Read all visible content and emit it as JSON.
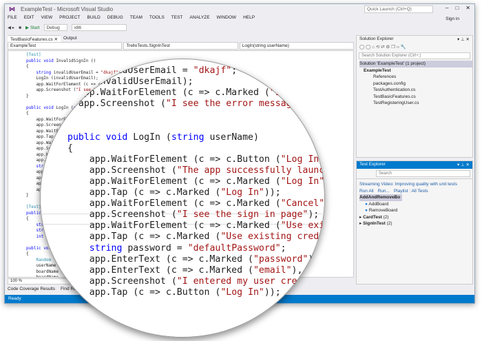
{
  "window": {
    "title": "ExampleTest - Microsoft Visual Studio",
    "quick_launch": "Quick Launch (Ctrl+Q)",
    "sign_in": "Sign in"
  },
  "menu": [
    "FILE",
    "EDIT",
    "VIEW",
    "PROJECT",
    "BUILD",
    "DEBUG",
    "TEAM",
    "TOOLS",
    "TEST",
    "ANALYZE",
    "WINDOW",
    "HELP"
  ],
  "toolbar": {
    "start": "▶ Start",
    "config": "Debug",
    "platform": "x86"
  },
  "tabs": [
    "TestBasicFeatures.cs",
    "Output"
  ],
  "nav": {
    "project": "ExampleTest",
    "class": "TrelloTests.SignInTest",
    "member": "LogIn(string userName)"
  },
  "editor": {
    "zoom": "100 %",
    "lines": [
      "[Test]",
      "public void InvalidSignIn ()",
      "{",
      "    string invalidUserEmail = \"dkajf\";",
      "    LogIn (invalidUserEmail);",
      "    app.WaitForElement (c => c.Marked (\"I see the pop up error\");",
      "    app.Screenshot (\"I see the error message\");",
      "}",
      "",
      "public void LogIn (string userName)",
      "{",
      "    app.WaitForElement",
      "    app.Screenshot",
      "    app.WaitForElement",
      "    app.Tap",
      "    app.WaitForElement",
      "    app.Screenshot",
      "    app.WaitForElement",
      "    app.Tap",
      "    string password",
      "    app.EnterText",
      "    app.EnterText",
      "    app.Screenshot",
      "    app.Tap",
      "}",
      "",
      "[Test]",
      "public void",
      "{",
      "    string",
      "    string",
      "    int",
      "",
      "public void",
      "{",
      "    Random",
      "    userName",
      "    boardName",
      "    boardName"
    ]
  },
  "magnifier": {
    "lines": [
      "    invalidUserEmail = \"dkajf\";",
      "    (invalidUserEmail);",
      "  app.WaitForElement (c => c.Marked (\"I see the pop up error\");",
      "  app.Screenshot (\"I see the error message\");",
      "",
      "",
      "public void LogIn (string userName)",
      "{",
      "    app.WaitForElement (c => c.Button (\"Log In\"));",
      "    app.Screenshot (\"The app successfully launched\");",
      "    app.WaitForElement (c => c.Marked (\"Log In\"));",
      "    app.Tap (c => c.Marked (\"Log In\"));",
      "    app.WaitForElement (c => c.Marked (\"Cancel\"));",
      "    app.Screenshot (\"I see the sign in page\");",
      "    app.WaitForElement (c => c.Marked (\"Use existing\"));",
      "    app.Tap (c => c.Marked (\"Use existing credentials\"));",
      "    string password = \"defaultPassword\";",
      "    app.EnterText (c => c.Marked (\"password\"), password);",
      "    app.EnterText (c => c.Marked (\"email\"), userName);",
      "    app.Screenshot (\"I entered my user credentials\");",
      "    app.Tap (c => c.Button (\"Log In\"));"
    ]
  },
  "bottom_tabs": [
    "Code Coverage Results",
    "Find Results 1"
  ],
  "status": "Ready",
  "solution_explorer": {
    "title": "Solution Explorer",
    "search": "Search Solution Explorer (Ctrl+;)",
    "items": [
      "Solution 'ExampleTest' (1 project)",
      "ExampleTest",
      "References",
      "packages.config",
      "TestAuthentication.cs",
      "TestBasicFeatures.cs",
      "TestRegisteringUser.cs"
    ]
  },
  "test_explorer": {
    "title": "Test Explorer",
    "search": "Search",
    "video": "Streaming Video: Improving quality with unit tests",
    "run_all": "Run All",
    "run": "Run...",
    "playlist": "Playlist : All Tests",
    "groups": [
      "AddAndRemoveBo",
      "AddBoard",
      "RemoveBoard",
      "CardTest",
      "(2)",
      "SignInTest",
      "(2)"
    ]
  }
}
